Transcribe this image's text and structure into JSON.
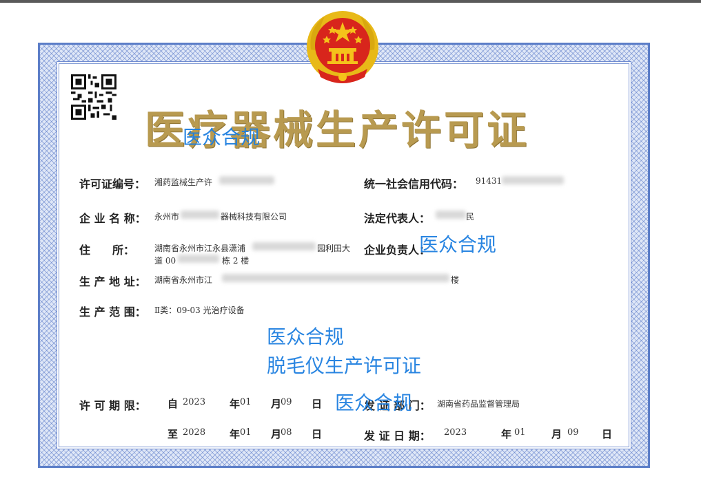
{
  "certificate": {
    "title": "医疗器械生产许可证",
    "fields": {
      "license_no_label": "许可证编号：",
      "license_no_value": "湘药监械生产许",
      "credit_code_label": "统一社会信用代码：",
      "credit_code_value": "91431",
      "company_label": "企 业 名 称：",
      "company_value_a": "永州市",
      "company_value_b": "器械科技有限公司",
      "legal_rep_label": "法定代表人：",
      "legal_rep_value": "民",
      "address_label": "住　　所：",
      "address_line1_a": "湖南省永州市江永县潇浦",
      "address_line1_b": "园利田大",
      "address_line2_a": "道 00",
      "address_line2_b": "栋 2 楼",
      "manager_label": "企业负责人：",
      "production_addr_label": "生 产 地 址：",
      "production_addr_value_a": "湖南省永州市江",
      "production_addr_value_b": "楼",
      "scope_label": "生 产 范 围：",
      "scope_value": "Ⅱ类：09-03 光治疗设备",
      "validity_label": "许 可 期 限：",
      "from_label": "自",
      "to_label": "至",
      "from_year": "2023",
      "from_month": "01",
      "from_day": "09",
      "to_year": "2028",
      "to_month": "01",
      "to_day": "08",
      "year_unit": "年",
      "month_unit": "月",
      "day_unit": "日",
      "issuer_label": "发 证 部 门：",
      "issuer_value": "湖南省药品监督管理局",
      "issue_date_label": "发 证 日 期：",
      "issue_year": "2023",
      "issue_month": "01",
      "issue_day": "09"
    }
  },
  "watermarks": [
    "医众合规",
    "医众合规",
    "医众合规",
    "脱毛仪生产许可证",
    "医众合规"
  ],
  "colors": {
    "border_blue": "#5c7ec8",
    "title_gold": "#b89a50",
    "watermark_blue": "#1e7fe0",
    "emblem_red": "#d8251c",
    "emblem_gold": "#f5c21b"
  },
  "icons": [
    "national-emblem-icon",
    "qr-code-icon"
  ]
}
